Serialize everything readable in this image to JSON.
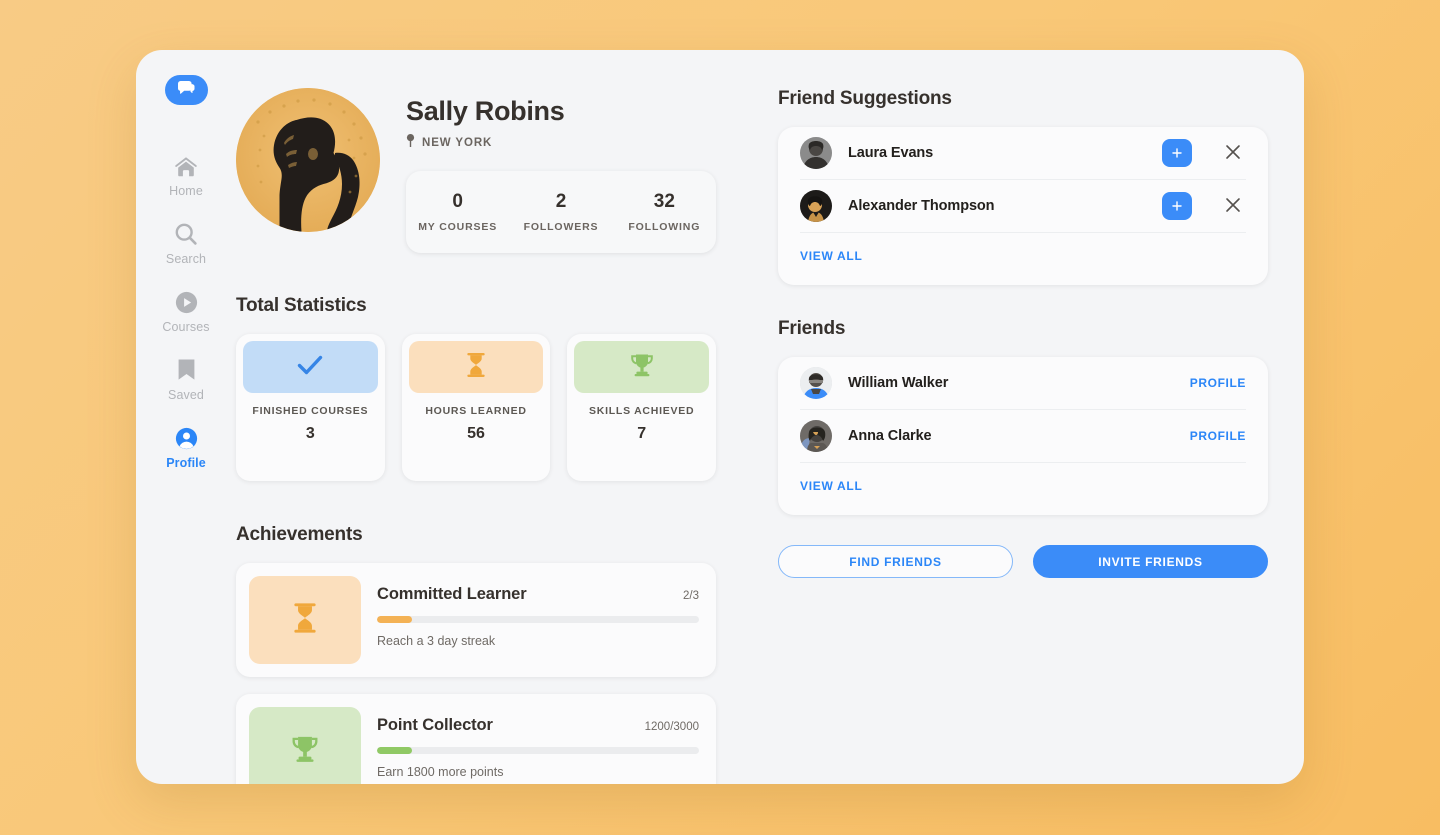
{
  "sidebar": {
    "logo_icon": "chat-bubble-icon",
    "items": [
      {
        "label": "Home",
        "icon": "home-icon",
        "active": false
      },
      {
        "label": "Search",
        "icon": "search-icon",
        "active": false
      },
      {
        "label": "Courses",
        "icon": "play-circle-icon",
        "active": false
      },
      {
        "label": "Saved",
        "icon": "bookmark-icon",
        "active": false
      },
      {
        "label": "Profile",
        "icon": "user-circle-icon",
        "active": true
      }
    ]
  },
  "profile": {
    "name": "Sally Robins",
    "location": "NEW YORK",
    "location_icon": "map-pin-icon",
    "avatar_name": "profile-avatar",
    "stats": [
      {
        "value": "0",
        "label": "MY COURSES"
      },
      {
        "value": "2",
        "label": "FOLLOWERS"
      },
      {
        "value": "32",
        "label": "FOLLOWING"
      }
    ]
  },
  "total_statistics": {
    "heading": "Total Statistics",
    "cards": [
      {
        "label": "FINISHED COURSES",
        "value": "3",
        "icon": "check-icon",
        "color": "blue"
      },
      {
        "label": "HOURS LEARNED",
        "value": "56",
        "icon": "hourglass-icon",
        "color": "orange"
      },
      {
        "label": "SKILLS ACHIEVED",
        "value": "7",
        "icon": "trophy-icon",
        "color": "green"
      }
    ]
  },
  "achievements": {
    "heading": "Achievements",
    "items": [
      {
        "title": "Committed Learner",
        "progress_text": "2/3",
        "description": "Reach a 3 day streak",
        "progress_percent": 11,
        "icon": "hourglass-icon",
        "color": "orange"
      },
      {
        "title": "Point Collector",
        "progress_text": "1200/3000",
        "description": "Earn 1800 more points",
        "progress_percent": 11,
        "icon": "trophy-icon",
        "color": "green"
      }
    ]
  },
  "friend_suggestions": {
    "heading": "Friend Suggestions",
    "people": [
      {
        "name": "Laura Evans",
        "add_icon": "plus-icon",
        "dismiss_icon": "close-icon"
      },
      {
        "name": "Alexander Thompson",
        "add_icon": "plus-icon",
        "dismiss_icon": "close-icon"
      }
    ],
    "view_all_label": "VIEW ALL"
  },
  "friends": {
    "heading": "Friends",
    "people": [
      {
        "name": "William Walker",
        "action_label": "PROFILE"
      },
      {
        "name": "Anna Clarke",
        "action_label": "PROFILE"
      }
    ],
    "view_all_label": "VIEW ALL",
    "actions": [
      {
        "label": "FIND FRIENDS",
        "style": "outline"
      },
      {
        "label": "INVITE FRIENDS",
        "style": "solid"
      }
    ]
  },
  "colors": {
    "accent_blue": "#3b8cf8",
    "page_background": "#f8c87b",
    "card_background": "#fbfbfc",
    "stat_blue": "#c2dcf7",
    "stat_orange": "#fbdfbd",
    "stat_green": "#d6e9c6"
  }
}
